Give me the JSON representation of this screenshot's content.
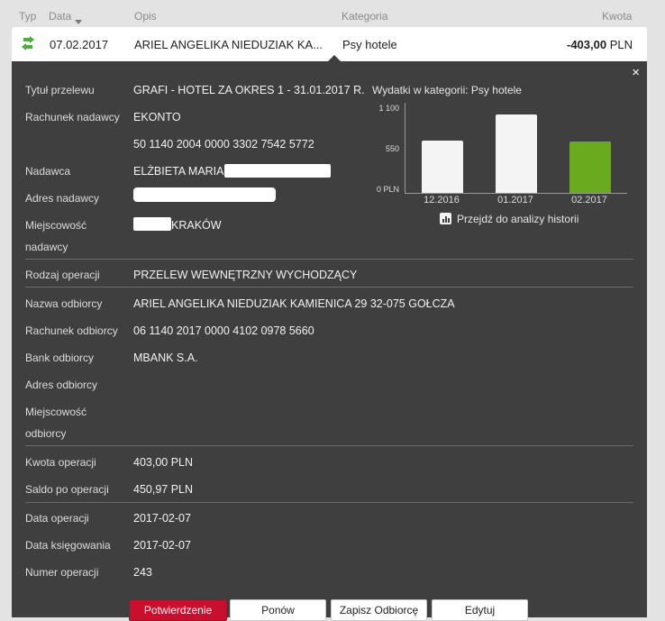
{
  "header": {
    "col_typ": "Typ",
    "col_data": "Data",
    "col_opis": "Opis",
    "col_kategoria": "Kategoria",
    "col_kwota": "Kwota"
  },
  "transaction": {
    "date": "07.02.2017",
    "description": "ARIEL ANGELIKA NIEDUZIAK KA...",
    "category": "Psy hotele",
    "amount": "-403,00",
    "currency": "PLN",
    "type_icon": "transfer-out-icon"
  },
  "details": {
    "close_symbol": "×",
    "tytul_label": "Tytuł przelewu",
    "tytul_value": "GRAFI - HOTEL ZA OKRES 1 - 31.01.2017 R.",
    "rachunek_nadawcy_label": "Rachunek nadawcy",
    "rachunek_nadawcy_value1": "EKONTO",
    "rachunek_nadawcy_value2": "50 1140 2004 0000 3302 7542 5772",
    "nadawca_label": "Nadawca",
    "nadawca_value": "ELŻBIETA MARIA",
    "adres_nadawcy_label": "Adres nadawcy",
    "miejscowosc_nadawcy_label1": "Miejscowość",
    "miejscowosc_nadawcy_label2": "nadawcy",
    "miejscowosc_nadawcy_value": "KRAKÓW",
    "rodzaj_label": "Rodzaj operacji",
    "rodzaj_value": "PRZELEW WEWNĘTRZNY WYCHODZĄCY",
    "nazwa_odbiorcy_label": "Nazwa odbiorcy",
    "nazwa_odbiorcy_value": "ARIEL ANGELIKA NIEDUZIAK KAMIENICA 29 32-075 GOŁCZA",
    "rachunek_odbiorcy_label": "Rachunek odbiorcy",
    "rachunek_odbiorcy_value": "06 1140 2017 0000 4102 0978 5660",
    "bank_label": "Bank odbiorcy",
    "bank_value": "MBANK S.A.",
    "adres_odbiorcy_label": "Adres odbiorcy",
    "miejscowosc_odbiorcy_label1": "Miejscowość",
    "miejscowosc_odbiorcy_label2": "odbiorcy",
    "kwota_label": "Kwota operacji",
    "kwota_value": "403,00 PLN",
    "saldo_label": "Saldo po operacji",
    "saldo_value": "450,97 PLN",
    "data_operacji_label": "Data operacji",
    "data_operacji_value": "2017-02-07",
    "data_ksiegowania_label": "Data księgowania",
    "data_ksiegowania_value": "2017-02-07",
    "numer_label": "Numer operacji",
    "numer_value": "243"
  },
  "chart": {
    "title": "Wydatki w kategorii:  Psy hotele",
    "history_link": "Przejdź do analizy historii",
    "colors": {
      "bar": "#f4f4f4",
      "current": "#6aaa1e"
    }
  },
  "chart_data": {
    "type": "bar",
    "categories": [
      "12.2016",
      "01.2017",
      "02.2017"
    ],
    "values": [
      640,
      960,
      630
    ],
    "yticks": [
      "0 PLN",
      "550",
      "1 100"
    ],
    "ylim": [
      0,
      1100
    ],
    "highlight_index": 2
  },
  "buttons": {
    "potwierdzenie": "Potwierdzenie",
    "ponow": "Ponów",
    "zapisz": "Zapisz Odbiorcę",
    "edytuj": "Edytuj"
  }
}
